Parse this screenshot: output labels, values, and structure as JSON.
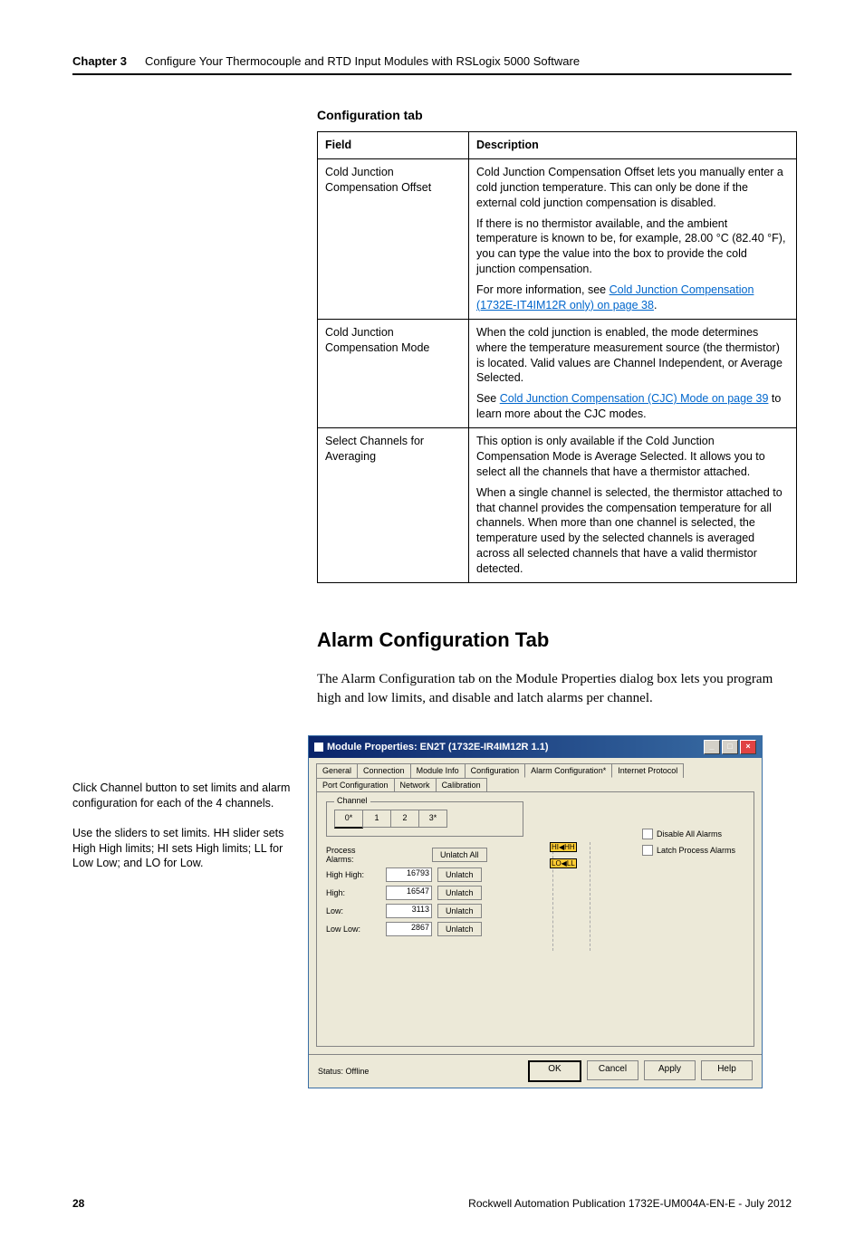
{
  "header": {
    "chapter": "Chapter 3",
    "title": "Configure Your Thermocouple and RTD Input Modules with RSLogix 5000 Software"
  },
  "table": {
    "caption": "Configuration tab",
    "head_field": "Field",
    "head_desc": "Description",
    "rows": [
      {
        "field": "Cold Junction Compensation Offset",
        "paras": [
          "Cold Junction Compensation Offset lets you manually enter a cold junction temperature. This can only be done if the external cold junction compensation is disabled.",
          "If there is no thermistor available, and the ambient temperature is known to be, for example, 28.00 °C (82.40 °F), you can type the value into the box to provide the cold junction compensation."
        ],
        "link_prefix": "For more information, see ",
        "link_text": "Cold Junction Compensation (1732E-IT4IM12R only) on page 38",
        "link_suffix": "."
      },
      {
        "field": "Cold Junction Compensation Mode",
        "paras": [
          "When the cold junction is enabled, the mode determines where the temperature measurement source (the thermistor) is located. Valid values are Channel Independent, or Average Selected."
        ],
        "link_prefix": "See ",
        "link_text": "Cold Junction Compensation (CJC) Mode on page 39",
        "link_suffix": " to learn more about the CJC modes."
      },
      {
        "field": "Select Channels for Averaging",
        "paras": [
          "This option is only available if the Cold Junction Compensation Mode is Average Selected. It allows you to select all the channels that have a thermistor attached.",
          "When a single channel is selected, the thermistor attached to that channel provides the compensation temperature for all channels. When more than one channel is selected, the temperature used by the selected channels is averaged across all selected channels that have a valid thermistor detected."
        ]
      }
    ]
  },
  "section": {
    "heading": "Alarm Configuration Tab",
    "body": "The Alarm Configuration tab on the Module Properties dialog box lets you program high and low limits, and disable and latch alarms per channel."
  },
  "callouts": {
    "c1": "Click Channel button to set limits and alarm configuration for each of the 4 channels.",
    "c2": "Use the sliders to set limits. HH slider sets High High limits; HI sets High limits; LL for Low Low; and LO for Low."
  },
  "dialog": {
    "title": "Module Properties: EN2T (1732E-IR4IM12R 1.1)",
    "tabs": [
      "General",
      "Connection",
      "Module Info",
      "Configuration",
      "Alarm Configuration*",
      "Internet Protocol",
      "Port Configuration",
      "Network",
      "Calibration"
    ],
    "active_tab": 4,
    "channel_label": "Channel",
    "channels": [
      "0*",
      "1",
      "2",
      "3*"
    ],
    "process_alarms_label": "Process Alarms:",
    "unlatch_all": "Unlatch All",
    "rows": [
      {
        "label": "High High:",
        "value": "16793",
        "btn": "Unlatch"
      },
      {
        "label": "High:",
        "value": "16547",
        "btn": "Unlatch"
      },
      {
        "label": "Low:",
        "value": "3113",
        "btn": "Unlatch"
      },
      {
        "label": "Low Low:",
        "value": "2867",
        "btn": "Unlatch"
      }
    ],
    "disable_all": "Disable All Alarms",
    "latch_process": "Latch Process Alarms",
    "markers": {
      "hh": "HH",
      "hi": "HI",
      "lo": "LO",
      "ll": "LL"
    },
    "status": "Status: Offline",
    "buttons": {
      "ok": "OK",
      "cancel": "Cancel",
      "apply": "Apply",
      "help": "Help"
    }
  },
  "footer": {
    "page": "28",
    "pub": "Rockwell Automation Publication 1732E-UM004A-EN-E - July 2012"
  }
}
